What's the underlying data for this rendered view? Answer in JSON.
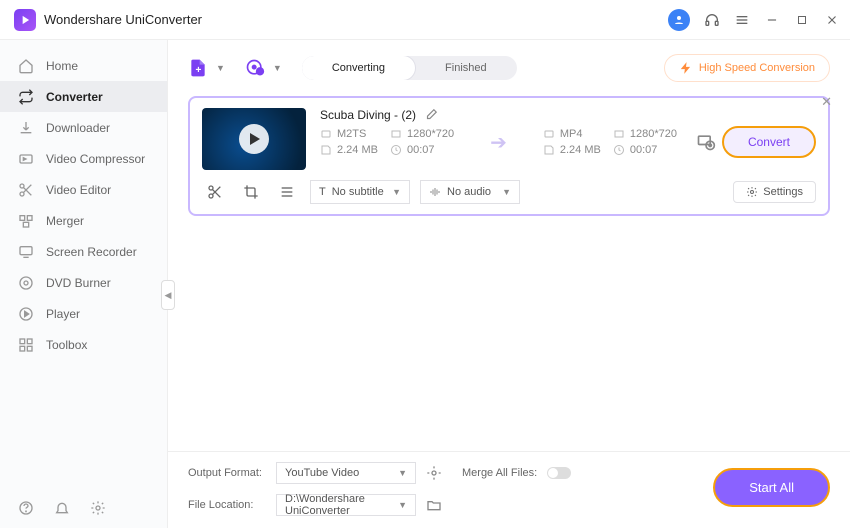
{
  "app": {
    "title": "Wondershare UniConverter"
  },
  "sidebar": {
    "items": [
      {
        "label": "Home"
      },
      {
        "label": "Converter"
      },
      {
        "label": "Downloader"
      },
      {
        "label": "Video Compressor"
      },
      {
        "label": "Video Editor"
      },
      {
        "label": "Merger"
      },
      {
        "label": "Screen Recorder"
      },
      {
        "label": "DVD Burner"
      },
      {
        "label": "Player"
      },
      {
        "label": "Toolbox"
      }
    ]
  },
  "tabs": {
    "converting": "Converting",
    "finished": "Finished"
  },
  "hs": "High Speed Conversion",
  "file": {
    "name": "Scuba Diving - (2)",
    "src": {
      "format": "M2TS",
      "res": "1280*720",
      "size": "2.24 MB",
      "dur": "00:07"
    },
    "dst": {
      "format": "MP4",
      "res": "1280*720",
      "size": "2.24 MB",
      "dur": "00:07"
    },
    "subtitle": "No subtitle",
    "audio": "No audio",
    "settings": "Settings",
    "convert": "Convert"
  },
  "bottom": {
    "output_label": "Output Format:",
    "output_value": "YouTube Video",
    "merge_label": "Merge All Files:",
    "loc_label": "File Location:",
    "loc_value": "D:\\Wondershare UniConverter",
    "start": "Start All"
  }
}
